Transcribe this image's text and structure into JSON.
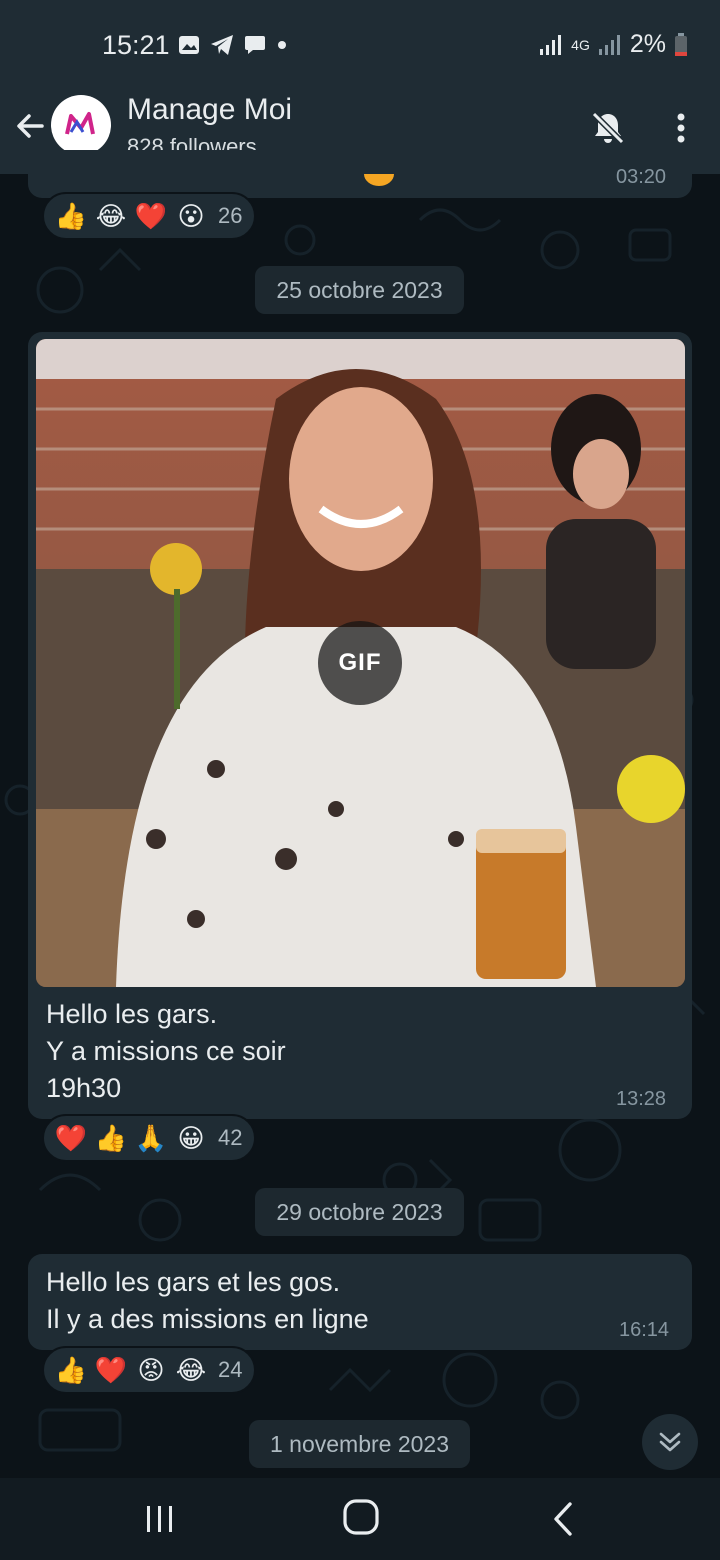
{
  "status_bar": {
    "time": "15:21",
    "network": "4G",
    "battery": "2%",
    "icons": [
      "gallery-icon",
      "telegram-icon",
      "chat-icon",
      "dot-icon",
      "signal-icon",
      "battery-icon"
    ]
  },
  "header": {
    "title": "Manage Moi",
    "subtitle": "828 followers"
  },
  "messages": [
    {
      "partial": true,
      "time": "03:20",
      "reactions": {
        "emojis": [
          "👍",
          "😂",
          "❤️",
          "😮"
        ],
        "count": "26"
      }
    },
    {
      "date_separator": "25 octobre 2023",
      "media": "GIF",
      "text": "Hello les gars.\nY a missions ce soir\n19h30",
      "time": "13:28",
      "reactions": {
        "emojis": [
          "❤️",
          "👍",
          "🙏",
          "😀"
        ],
        "count": "42"
      }
    },
    {
      "date_separator": "29 octobre 2023",
      "text": "Hello les gars et les gos.\nIl y a des missions en ligne",
      "time": "16:14",
      "reactions": {
        "emojis": [
          "👍",
          "❤️",
          "😡",
          "😂"
        ],
        "count": "24"
      }
    }
  ],
  "last_date_separator": "1 novembre 2023",
  "colors": {
    "background": "#0c1318",
    "bubble": "#1f2c34",
    "header": "#1f2c34",
    "text": "#e9edef",
    "muted": "#8696a0"
  }
}
